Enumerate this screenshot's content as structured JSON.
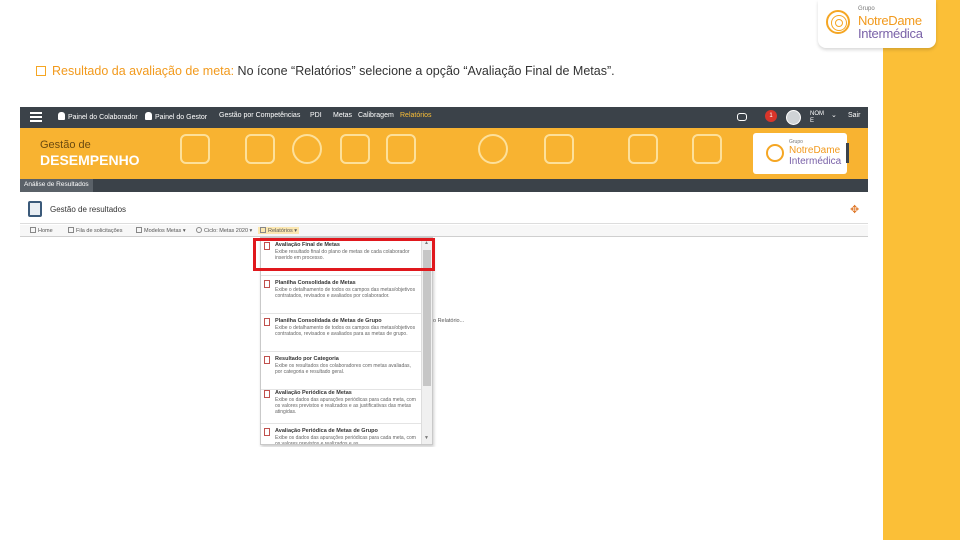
{
  "colors": {
    "accent": "#f5a623",
    "strip": "#fbbf37",
    "highlight": "#e0181d",
    "topbar": "#3b4249"
  },
  "slide_logo": {
    "grupo": "Grupo",
    "name_line1": "NotreDame",
    "name_line2": "Intermédica"
  },
  "instruction": {
    "bullet_icon": "checkbox-icon",
    "highlight": "Resultado da avaliação de meta:",
    "text": " No ícone “Relatórios” selecione a opção “Avaliação Final de Metas”."
  },
  "topbar": {
    "nav": [
      "Painel do Colaborador",
      "Painel do Gestor",
      "Gestão por Competências",
      "PDI",
      "Metas",
      "Calibragem",
      "Relatórios"
    ],
    "notification_count": "1",
    "user_name": "NOME",
    "logout": "Sair"
  },
  "banner": {
    "title_line1": "Gestão de",
    "title_line2": "DESEMPENHO",
    "logo": {
      "grupo": "Grupo",
      "name_line1": "NotreDame",
      "name_line2": "Intermédica"
    }
  },
  "tab": {
    "label": "Análise de Resultados"
  },
  "page": {
    "title": "Gestão de resultados"
  },
  "toolbar": {
    "items": [
      "Home",
      "Fila de solicitações",
      "Modelos Metas",
      "Ciclo: Metas 2020",
      "Relatórios"
    ]
  },
  "dropdown": {
    "items": [
      {
        "title": "Avaliação Final de Metas",
        "desc": "Exibe resultado final do plano de metas de cada colaborador inserido em processo."
      },
      {
        "title": "Planilha Consolidada de Metas",
        "desc": "Exibe o detalhamento de todos os campos das metas/objetivos contratados, revisados e avaliados por colaborador."
      },
      {
        "title": "Planilha Consolidada de Metas de Grupo",
        "desc": "Exibe o detalhamento de todos os campos das metas/objetivos contratados, revisados e avaliados para as metas de grupo."
      },
      {
        "title": "Resultado por Categoria",
        "desc": "Exibe os resultados dos colaboradores com metas avaliadas, por categoria e resultado geral."
      },
      {
        "title": "Avaliação Periódica de Metas",
        "desc": "Exibe os dados das apurações periódicas para cada meta, com os valores previstos e realizados e as justificativas das metas atingidas."
      },
      {
        "title": "Avaliação Periódica de Metas de Grupo",
        "desc": "Exibe os dados das apurações periódicas para cada meta, com os valores previstos e realizados e as"
      }
    ]
  },
  "relatorio_hint": "o Relatório..."
}
